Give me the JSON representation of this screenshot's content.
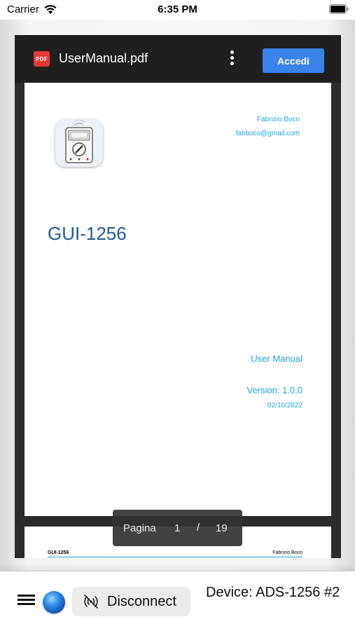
{
  "status_bar": {
    "carrier": "Carrier",
    "time": "6:35 PM"
  },
  "viewer": {
    "badge": "PDF",
    "file_name": "UserManual.pdf",
    "login_button": "Accedi",
    "menu_icon": "more-vertical-icon"
  },
  "page1": {
    "author": "Fabrizio Boco",
    "email": "fabboco@gmail.com",
    "title": "GUI-1256",
    "subtitle": "User Manual",
    "version": "Version: 1.0.0",
    "date": "02/10/2022"
  },
  "page2": {
    "header_left": "GUI-1256",
    "header_right": "Fabrizio Boco"
  },
  "page_indicator": {
    "label": "Pagina",
    "current": "1",
    "separator": "/",
    "total": "19"
  },
  "bottom_bar": {
    "disconnect_label": "Disconnect",
    "device_label": "Device: ADS-1256 #2",
    "status_color": "#2f8de8"
  },
  "colors": {
    "accent_blue": "#3b82e9",
    "link_blue": "#1fa3d6",
    "title_blue": "#1e5b94",
    "pdf_red": "#e53935"
  }
}
